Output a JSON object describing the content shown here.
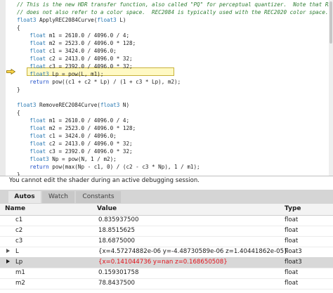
{
  "code": {
    "lines": [
      "// This is the new HDR transfer function, also called \"PQ\" for perceptual quantizer.  Note that REC2084",
      "// does not also refer to a color space.  REC2084 is typically used with the REC2020 color space.",
      "float3 ApplyREC2084Curve(float3 L)",
      "{",
      "    float m1 = 2610.0 / 4096.0 / 4;",
      "    float m2 = 2523.0 / 4096.0 * 128;",
      "    float c1 = 3424.0 / 4096.0;",
      "    float c2 = 2413.0 / 4096.0 * 32;",
      "    float c3 = 2392.0 / 4096.0 * 32;",
      "    float3 Lp = pow(L, m1);",
      "    return pow((c1 + c2 * Lp) / (1 + c3 * Lp), m2);",
      "}",
      "",
      "float3 RemoveREC2084Curve(float3 N)",
      "{",
      "    float m1 = 2610.0 / 4096.0 / 4;",
      "    float m2 = 2523.0 / 4096.0 * 128;",
      "    float c1 = 3424.0 / 4096.0;",
      "    float c2 = 2413.0 / 4096.0 * 32;",
      "    float c3 = 2392.0 / 4096.0 * 32;",
      "    float3 Np = pow(N, 1 / m2);",
      "    return pow(max(Np - c1, 0) / (c2 - c3 * Np), 1 / m1);",
      "}"
    ],
    "current_statement_icon": "yellow-arrow-icon"
  },
  "message": "You cannot edit the shader during an active debugging session.",
  "tabs": [
    {
      "label": "Autos",
      "active": true
    },
    {
      "label": "Watch",
      "active": false
    },
    {
      "label": "Constants",
      "active": false
    }
  ],
  "columns": {
    "name": "Name",
    "value": "Value",
    "type": "Type"
  },
  "rows": [
    {
      "name": "c1",
      "value": "0.835937500",
      "type": "float",
      "expandable": false,
      "changed": false,
      "selected": false
    },
    {
      "name": "c2",
      "value": "18.8515625",
      "type": "float",
      "expandable": false,
      "changed": false,
      "selected": false
    },
    {
      "name": "c3",
      "value": "18.6875000",
      "type": "float",
      "expandable": false,
      "changed": false,
      "selected": false
    },
    {
      "name": "L",
      "value": "{x=4.57274882e-06 y=-4.48730589e-06 z=1.40441862e-05}",
      "type": "float3",
      "expandable": true,
      "changed": false,
      "selected": false
    },
    {
      "name": "Lp",
      "value": "{x=0.141044736 y=nan z=0.168650508}",
      "type": "float3",
      "expandable": true,
      "changed": true,
      "selected": true
    },
    {
      "name": "m1",
      "value": "0.159301758",
      "type": "float",
      "expandable": false,
      "changed": false,
      "selected": false
    },
    {
      "name": "m2",
      "value": "78.8437500",
      "type": "float",
      "expandable": false,
      "changed": false,
      "selected": false
    }
  ],
  "colors": {
    "changed_value": "#e0111a",
    "selected_row": "#d8d8d8",
    "statement_highlight": "#fff9c4"
  }
}
